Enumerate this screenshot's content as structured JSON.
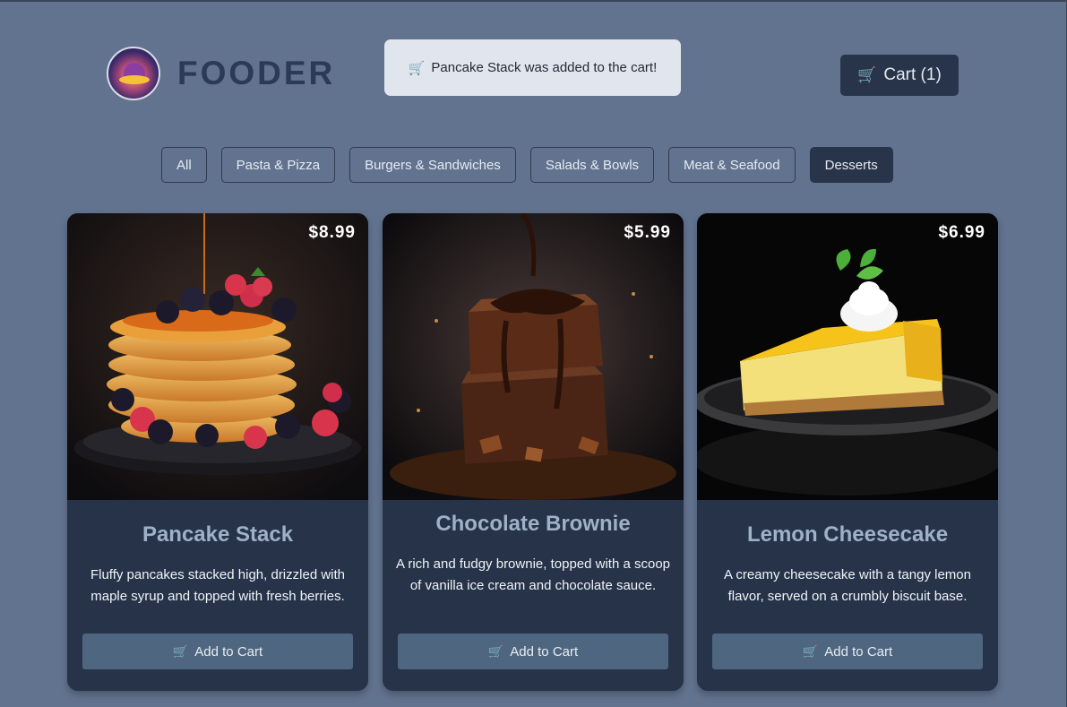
{
  "brand": {
    "name": "FOODER",
    "logo_icon": "food-dome-logo-icon"
  },
  "toast": {
    "icon": "cart-icon",
    "message": "Pancake Stack was added to the cart!"
  },
  "cart": {
    "icon": "cart-icon",
    "label": "Cart (1)"
  },
  "filters": [
    {
      "label": "All",
      "active": false
    },
    {
      "label": "Pasta & Pizza",
      "active": false
    },
    {
      "label": "Burgers & Sandwiches",
      "active": false
    },
    {
      "label": "Salads & Bowls",
      "active": false
    },
    {
      "label": "Meat & Seafood",
      "active": false
    },
    {
      "label": "Desserts",
      "active": true
    }
  ],
  "products": [
    {
      "name": "Pancake Stack",
      "price": "$8.99",
      "description": "Fluffy pancakes stacked high, drizzled with maple syrup and topped with fresh berries.",
      "button_label": "Add to Cart",
      "image_icon": "pancake-stack-photo"
    },
    {
      "name": "Chocolate Brownie",
      "price": "$5.99",
      "description": "A rich and fudgy brownie, topped with a scoop of vanilla ice cream and chocolate sauce.",
      "button_label": "Add to Cart",
      "image_icon": "chocolate-brownie-photo"
    },
    {
      "name": "Lemon Cheesecake",
      "price": "$6.99",
      "description": "A creamy cheesecake with a tangy lemon flavor, served on a crumbly biscuit base.",
      "button_label": "Add to Cart",
      "image_icon": "lemon-cheesecake-photo"
    }
  ],
  "colors": {
    "background": "#62738f",
    "card": "#263349",
    "button": "#4e6680",
    "cart_button": "#273449",
    "toast": "#e1e6ee",
    "title": "#9fb1c6"
  }
}
